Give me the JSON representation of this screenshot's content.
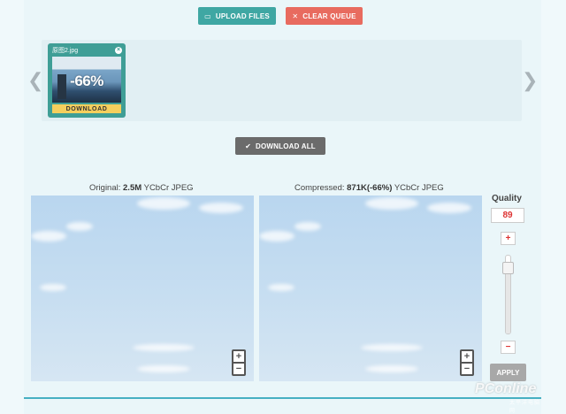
{
  "toolbar": {
    "upload_label": "UPLOAD FILES",
    "clear_label": "CLEAR QUEUE",
    "download_all_label": "DOWNLOAD ALL",
    "upload_icon": "folder-open-icon",
    "clear_icon": "close-icon",
    "download_all_icon": "checkmark-icon"
  },
  "queue": {
    "items": [
      {
        "filename": "原图2.jpg",
        "reduction": "-66%",
        "download_label": "DOWNLOAD"
      }
    ],
    "prev_icon": "chevron-left-icon",
    "next_icon": "chevron-right-icon"
  },
  "compare": {
    "original_prefix": "Original:",
    "original_size": "2.5M",
    "original_format": "YCbCr JPEG",
    "compressed_prefix": "Compressed:",
    "compressed_size": "871K(-66%)",
    "compressed_format": "YCbCr JPEG"
  },
  "quality": {
    "label": "Quality",
    "value": "89",
    "plus": "+",
    "minus": "−",
    "apply_label": "APPLY",
    "level": 0.89
  },
  "watermark": {
    "text": "PConline",
    "sub": "太平洋电脑网"
  },
  "colors": {
    "upload": "#3fa7a3",
    "clear": "#e86b5f",
    "download_all": "#6b6b6b",
    "thumb_bg": "#3f9e96",
    "download_btn": "#f5cf5d",
    "quality_value": "#dd3333"
  }
}
